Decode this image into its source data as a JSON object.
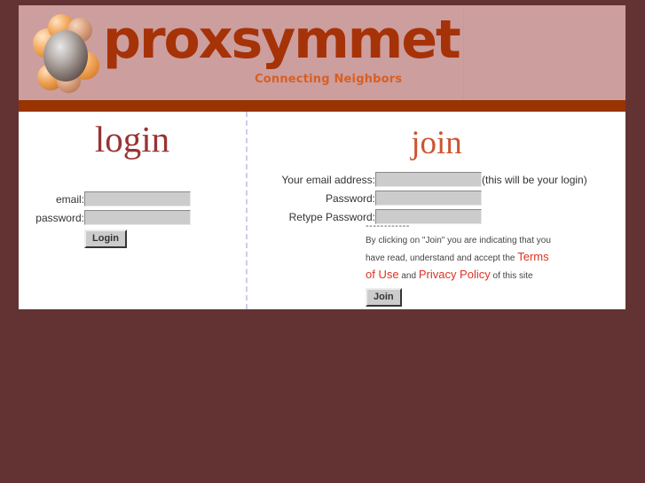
{
  "colors": {
    "page_background": "#633333",
    "banner_background": "#cc9e9e",
    "rust_bar": "#993300",
    "wordmark": "#a63208",
    "tagline": "#d95f22",
    "login_heading": "#993333",
    "join_heading": "#cc5533",
    "link": "#dd3322",
    "field_fill": "#cccccc",
    "divider": "#ccccee"
  },
  "banner": {
    "logo_icon": "molecule-logo-icon",
    "wordmark": "proxsymmetry",
    "tagline": "Connecting Neighbors"
  },
  "login": {
    "heading": "login",
    "fields": [
      {
        "label": "email:",
        "value": "",
        "placeholder": "",
        "name": "email-field"
      },
      {
        "label": "password:",
        "value": "",
        "placeholder": "",
        "name": "password-field"
      }
    ],
    "submit_label": "Login"
  },
  "join": {
    "heading": "join",
    "fields": [
      {
        "label": "Your email address:",
        "value": "",
        "placeholder": "",
        "hint": "(this will be your login)"
      },
      {
        "label": "Password:",
        "value": "",
        "placeholder": "",
        "hint": ""
      },
      {
        "label": "Retype Password:",
        "value": "",
        "placeholder": "",
        "hint": ""
      }
    ],
    "divider": "------------",
    "terms": {
      "line_before": "By clicking on \"Join\" you are indicating that you have read, understand and accept the ",
      "terms_link": "Terms of Use",
      "conjunction": " and ",
      "privacy_link": "Privacy Policy",
      "line_after": " of this site"
    },
    "submit_label": "Join"
  }
}
